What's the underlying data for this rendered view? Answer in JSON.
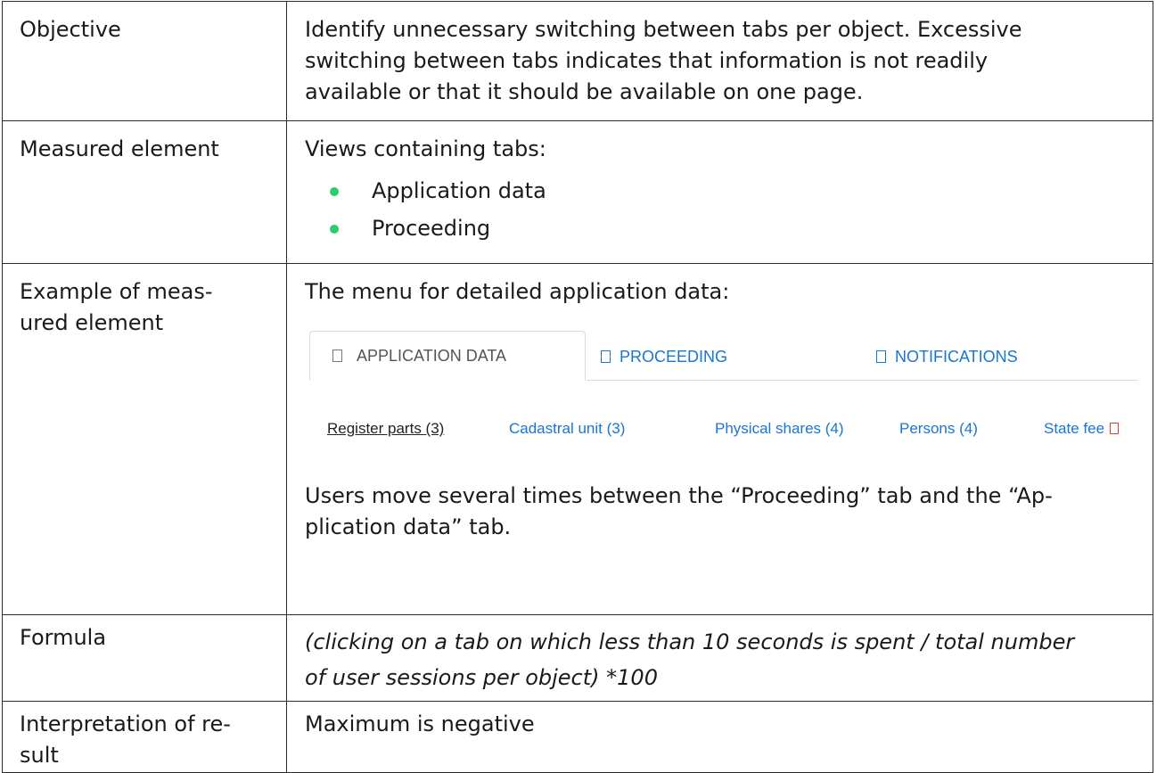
{
  "rows": {
    "objective": {
      "label": [
        "Objective"
      ],
      "value": [
        "Identify unnecessary switching between tabs per object. Excessive",
        "switching between tabs indicates that information is not readily",
        "available or that it should be available on one page."
      ]
    },
    "measured": {
      "label": [
        "Measured element"
      ],
      "intro": "Views containing tabs:",
      "items": [
        "Application data",
        "Proceeding"
      ]
    },
    "example": {
      "label": [
        "Example of meas-",
        "ured element"
      ],
      "intro": "The menu for detailed application data:",
      "screenshot": {
        "tabs": [
          {
            "label": "APPLICATION DATA",
            "active": true,
            "icon": "document-icon"
          },
          {
            "label": "PROCEEDING",
            "active": false,
            "icon": "document-icon"
          },
          {
            "label": "NOTIFICATIONS",
            "active": false,
            "icon": "document-icon"
          }
        ],
        "sublinks": [
          {
            "label": "Register parts (3)",
            "current": true
          },
          {
            "label": "Cadastral unit (3)",
            "current": false
          },
          {
            "label": "Physical shares (4)",
            "current": false
          },
          {
            "label": "Persons (4)",
            "current": false
          },
          {
            "label": "State fee",
            "current": false,
            "icon": "alert-icon",
            "icon_color": "#e53935"
          }
        ],
        "link_color": "#1976d2"
      },
      "note": [
        "Users move several times between the “Proceeding” tab and the “Ap-",
        "plication data” tab."
      ]
    },
    "formula": {
      "label": [
        "Formula"
      ],
      "value": [
        "(clicking on a tab on which less than 10 seconds is spent / total number",
        "of user sessions per object) *100"
      ]
    },
    "interpretation": {
      "label": [
        "Interpretation of re-",
        "sult"
      ],
      "value": [
        "Maximum is negative"
      ]
    }
  },
  "colors": {
    "bullet": "#2ecc71",
    "border": "#2b2b2b"
  }
}
